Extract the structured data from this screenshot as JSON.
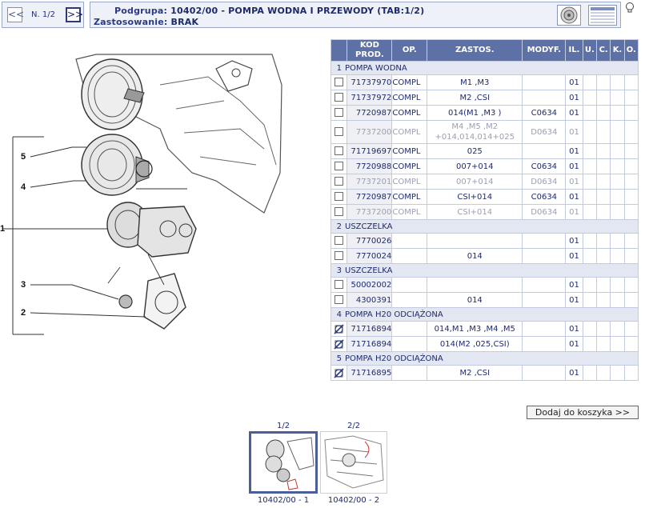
{
  "nav": {
    "prev": "<<",
    "page": "N. 1/2",
    "next": ">>"
  },
  "header": {
    "podgrupa_label": "Podgrupa:",
    "podgrupa_value": "10402/00 - POMPA WODNA I PRZEWODY (TAB:1/2)",
    "zastosowanie_label": "Zastosowanie:",
    "zastosowanie_value": "BRAK"
  },
  "table": {
    "columns": [
      "KOD PROD.",
      "OP.",
      "ZASTOS.",
      "MODYF.",
      "IL.",
      "U.",
      "C.",
      "K.",
      "O."
    ],
    "groups": [
      {
        "num": "1",
        "name": "POMPA WODNA",
        "rows": [
          {
            "code": "71737970",
            "op": "COMPL",
            "zastos": "M1 ,M3",
            "modyf": "",
            "il": "01",
            "dim": false,
            "mark": "box"
          },
          {
            "code": "71737972",
            "op": "COMPL",
            "zastos": "M2 ,CSI",
            "modyf": "",
            "il": "01",
            "dim": false,
            "mark": "box"
          },
          {
            "code": "7720987",
            "op": "COMPL",
            "zastos": "014(M1 ,M3 )",
            "modyf": "C0634",
            "il": "01",
            "dim": false,
            "mark": "box"
          },
          {
            "code": "7737200",
            "op": "COMPL",
            "zastos": "M4 ,M5 ,M2 +014,014,014+025",
            "modyf": "D0634",
            "il": "01",
            "dim": true,
            "mark": "box"
          },
          {
            "code": "71719697",
            "op": "COMPL",
            "zastos": "025",
            "modyf": "",
            "il": "01",
            "dim": false,
            "mark": "box"
          },
          {
            "code": "7720988",
            "op": "COMPL",
            "zastos": "007+014",
            "modyf": "C0634",
            "il": "01",
            "dim": false,
            "mark": "box"
          },
          {
            "code": "7737201",
            "op": "COMPL",
            "zastos": "007+014",
            "modyf": "D0634",
            "il": "01",
            "dim": true,
            "mark": "box"
          },
          {
            "code": "7720987",
            "op": "COMPL",
            "zastos": "CSI+014",
            "modyf": "C0634",
            "il": "01",
            "dim": false,
            "mark": "box"
          },
          {
            "code": "7737200",
            "op": "COMPL",
            "zastos": "CSI+014",
            "modyf": "D0634",
            "il": "01",
            "dim": true,
            "mark": "box"
          }
        ]
      },
      {
        "num": "2",
        "name": "USZCZELKA",
        "rows": [
          {
            "code": "7770026",
            "op": "",
            "zastos": "",
            "modyf": "",
            "il": "01",
            "dim": false,
            "mark": "box"
          },
          {
            "code": "7770024",
            "op": "",
            "zastos": "014",
            "modyf": "",
            "il": "01",
            "dim": false,
            "mark": "box"
          }
        ]
      },
      {
        "num": "3",
        "name": "USZCZELKA",
        "rows": [
          {
            "code": "50002002",
            "op": "",
            "zastos": "",
            "modyf": "",
            "il": "01",
            "dim": false,
            "mark": "box"
          },
          {
            "code": "4300391",
            "op": "",
            "zastos": "014",
            "modyf": "",
            "il": "01",
            "dim": false,
            "mark": "box"
          }
        ]
      },
      {
        "num": "4",
        "name": "POMPA H20 ODCIĄŻONA",
        "rows": [
          {
            "code": "71716894",
            "op": "",
            "zastos": "014,M1 ,M3 ,M4 ,M5",
            "modyf": "",
            "il": "01",
            "dim": false,
            "mark": "blocked"
          },
          {
            "code": "71716894",
            "op": "",
            "zastos": "014(M2 ,025,CSI)",
            "modyf": "",
            "il": "01",
            "dim": false,
            "mark": "blocked"
          }
        ]
      },
      {
        "num": "5",
        "name": "POMPA H20 ODCIĄŻONA",
        "rows": [
          {
            "code": "71716895",
            "op": "",
            "zastos": "M2 ,CSI",
            "modyf": "",
            "il": "01",
            "dim": false,
            "mark": "blocked"
          }
        ]
      }
    ]
  },
  "drawing": {
    "callouts": [
      "5",
      "4",
      "1",
      "3",
      "2"
    ]
  },
  "add_button": "Dodaj do koszyka >>",
  "thumbnails": [
    {
      "top_label": "1/2",
      "caption": "10402/00 - 1",
      "selected": true
    },
    {
      "top_label": "2/2",
      "caption": "10402/00 - 2",
      "selected": false
    }
  ],
  "colors": {
    "header_bg": "#5d71a6",
    "group_bg": "#e3e7f1",
    "code_bg": "#eef0f6",
    "text": "#1e2a6e",
    "dim_text": "#9aa0b4"
  }
}
